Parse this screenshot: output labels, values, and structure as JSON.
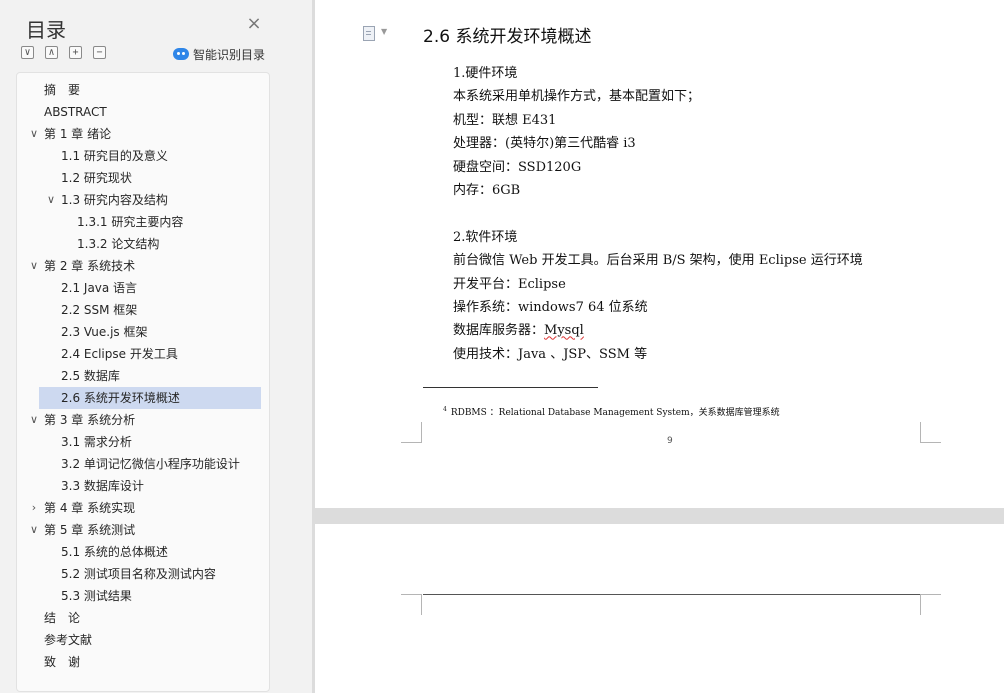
{
  "sidebar": {
    "title": "目录",
    "tools": [
      "∨",
      "∧",
      "+",
      "−"
    ],
    "smart_label": "智能识别目录",
    "items": [
      {
        "label": "摘　要",
        "level": 1,
        "chevron": ""
      },
      {
        "label": "ABSTRACT",
        "level": 1,
        "chevron": ""
      },
      {
        "label": "第 1 章  绪论",
        "level": 1,
        "chevron": "∨"
      },
      {
        "label": "1.1  研究目的及意义",
        "level": 2,
        "chevron": ""
      },
      {
        "label": "1.2  研究现状",
        "level": 2,
        "chevron": ""
      },
      {
        "label": "1.3 研究内容及结构",
        "level": 2,
        "chevron": "∨"
      },
      {
        "label": "1.3.1 研究主要内容",
        "level": 3,
        "chevron": ""
      },
      {
        "label": "1.3.2 论文结构",
        "level": 3,
        "chevron": ""
      },
      {
        "label": "第 2 章  系统技术",
        "level": 1,
        "chevron": "∨"
      },
      {
        "label": "2.1 Java 语言",
        "level": 2,
        "chevron": ""
      },
      {
        "label": "2.2 SSM 框架",
        "level": 2,
        "chevron": ""
      },
      {
        "label": "2.3 Vue.js 框架",
        "level": 2,
        "chevron": ""
      },
      {
        "label": "2.4 Eclipse 开发工具",
        "level": 2,
        "chevron": ""
      },
      {
        "label": "2.5  数据库",
        "level": 2,
        "chevron": ""
      },
      {
        "label": "2.6 系统开发环境概述",
        "level": 2,
        "chevron": "",
        "selected": true
      },
      {
        "label": "第 3 章  系统分析",
        "level": 1,
        "chevron": "∨"
      },
      {
        "label": "3.1 需求分析",
        "level": 2,
        "chevron": ""
      },
      {
        "label": "3.2 单词记忆微信小程序功能设计",
        "level": 2,
        "chevron": ""
      },
      {
        "label": "3.3 数据库设计",
        "level": 2,
        "chevron": ""
      },
      {
        "label": "第 4 章  系统实现",
        "level": 1,
        "chevron": "›"
      },
      {
        "label": "第 5 章  系统测试",
        "level": 1,
        "chevron": "∨"
      },
      {
        "label": "5.1 系统的总体概述",
        "level": 2,
        "chevron": ""
      },
      {
        "label": "5.2 测试项目名称及测试内容",
        "level": 2,
        "chevron": ""
      },
      {
        "label": "5.3 测试结果",
        "level": 2,
        "chevron": ""
      },
      {
        "label": "结　论",
        "level": 1,
        "chevron": ""
      },
      {
        "label": "参考文献",
        "level": 1,
        "chevron": ""
      },
      {
        "label": "致　谢",
        "level": 1,
        "chevron": ""
      }
    ]
  },
  "document": {
    "heading": "2.6 系统开发环境概述",
    "lines": [
      "1.硬件环境",
      "本系统采用单机操作方式，基本配置如下；",
      "机型：联想 E431",
      "处理器：(英特尔)第三代酷睿  i3",
      "硬盘空间：SSD120G",
      "内存：6GB",
      "",
      "2.软件环境",
      "前台微信 Web 开发工具。后台采用 B/S 架构，使用 Eclipse 运行环境",
      "开发平台：Eclipse",
      "操作系统：windows7 64 位系统",
      "数据库服务器：Mysql",
      "使用技术：Java  、JSP、SSM 等"
    ],
    "footnote_mark": "4",
    "footnote": "RDBMS  ：Relational Database Management System，关系数据库管理系统",
    "page_number": "9"
  }
}
